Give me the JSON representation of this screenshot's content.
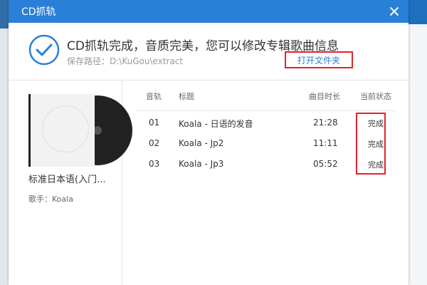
{
  "window": {
    "title": "CD抓轨"
  },
  "header": {
    "status": "CD抓轨完成，音质完美，您可以修改专辑歌曲信息",
    "save_path": "保存路径：D:\\KuGou\\extract",
    "open_folder_label": "打开文件夹"
  },
  "album": {
    "name": "标准日本语(入门...",
    "artist": "歌手：Koala"
  },
  "table": {
    "columns": {
      "track": "音轨",
      "title": "标题",
      "duration": "曲目时长",
      "status": "当前状态"
    },
    "rows": [
      {
        "track": "01",
        "title": "Koala - 日语的发音",
        "duration": "21:28",
        "status": "完成"
      },
      {
        "track": "02",
        "title": "Koala - Jp2",
        "duration": "11:11",
        "status": "完成"
      },
      {
        "track": "03",
        "title": "Koala - Jp3",
        "duration": "05:52",
        "status": "完成"
      }
    ]
  },
  "icons": {
    "success": "check-circle-icon",
    "close": "close-icon"
  },
  "colors": {
    "titlebar": "#2a7fd6",
    "accent": "#2a7fd6",
    "highlight": "#e0242c"
  }
}
